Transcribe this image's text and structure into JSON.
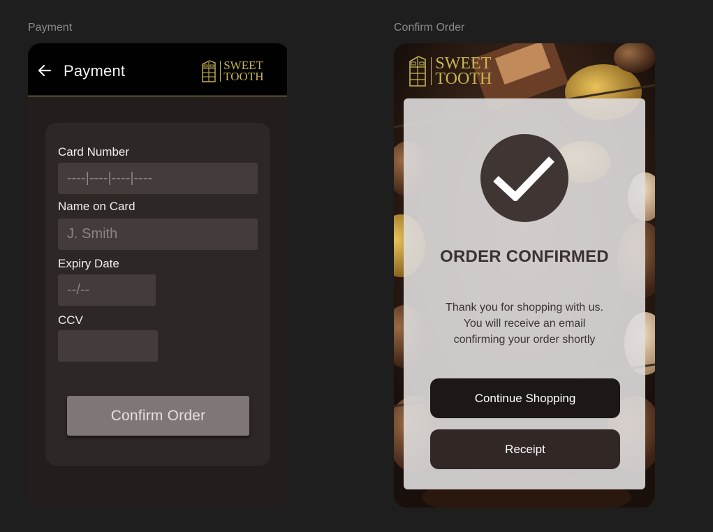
{
  "frames": {
    "payment_label": "Payment",
    "confirm_label": "Confirm Order"
  },
  "brand": {
    "line1": "SWEET",
    "line2": "TOOTH",
    "gold": "#c8b653"
  },
  "payment": {
    "title": "Payment",
    "back_icon": "arrow-left-icon",
    "fields": {
      "card_number": {
        "label": "Card Number",
        "placeholder": "----|----|----|----"
      },
      "name": {
        "label": "Name on Card",
        "placeholder": "J. Smith"
      },
      "expiry": {
        "label": "Expiry Date",
        "placeholder": "--/--"
      },
      "ccv": {
        "label": "CCV",
        "placeholder": ""
      }
    },
    "confirm_button": "Confirm Order"
  },
  "confirm": {
    "icon": "checkmark-icon",
    "title": "ORDER CONFIRMED",
    "message": [
      "Thank you for shopping with us.",
      "You will receive an email",
      "confirming your order shortly"
    ],
    "continue_button": "Continue Shopping",
    "receipt_button": "Receipt"
  },
  "colors": {
    "background": "#1e1e1e",
    "phone_bg": "#231e1d",
    "card_bg": "#2d2726",
    "field_bg": "#433c3b",
    "button_gray": "#7f7776",
    "button_dark": "#1d1817"
  }
}
